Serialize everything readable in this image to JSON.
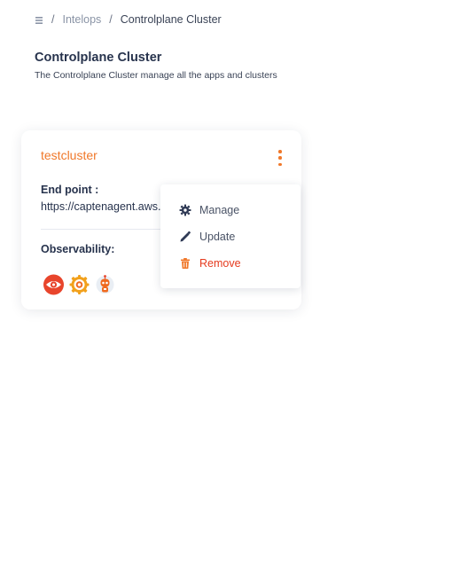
{
  "breadcrumb": {
    "home_icon": "home-icon",
    "separator": "/",
    "items": [
      "Intelops",
      "Controlplane Cluster"
    ]
  },
  "page": {
    "title": "Controlplane Cluster",
    "subtitle": "The Controlplane Cluster manage all the apps and clusters"
  },
  "cluster_card": {
    "name": "testcluster",
    "menu_icon": "kebab-menu-icon",
    "endpoint_label": "End point :",
    "endpoint_value": "https://captenagent.aws.dev.optimizor.app",
    "observability_label": "Observability:",
    "observability_icons": [
      "eye-icon",
      "grafana-icon",
      "robot-icon"
    ]
  },
  "menu": {
    "items": [
      {
        "label": "Manage",
        "icon": "gear-icon"
      },
      {
        "label": "Update",
        "icon": "pencil-icon"
      },
      {
        "label": "Remove",
        "icon": "trash-icon"
      }
    ]
  },
  "colors": {
    "accent": "#f0782a",
    "danger": "#e53a1e",
    "title": "#27334d",
    "muted": "#8a94a6"
  }
}
